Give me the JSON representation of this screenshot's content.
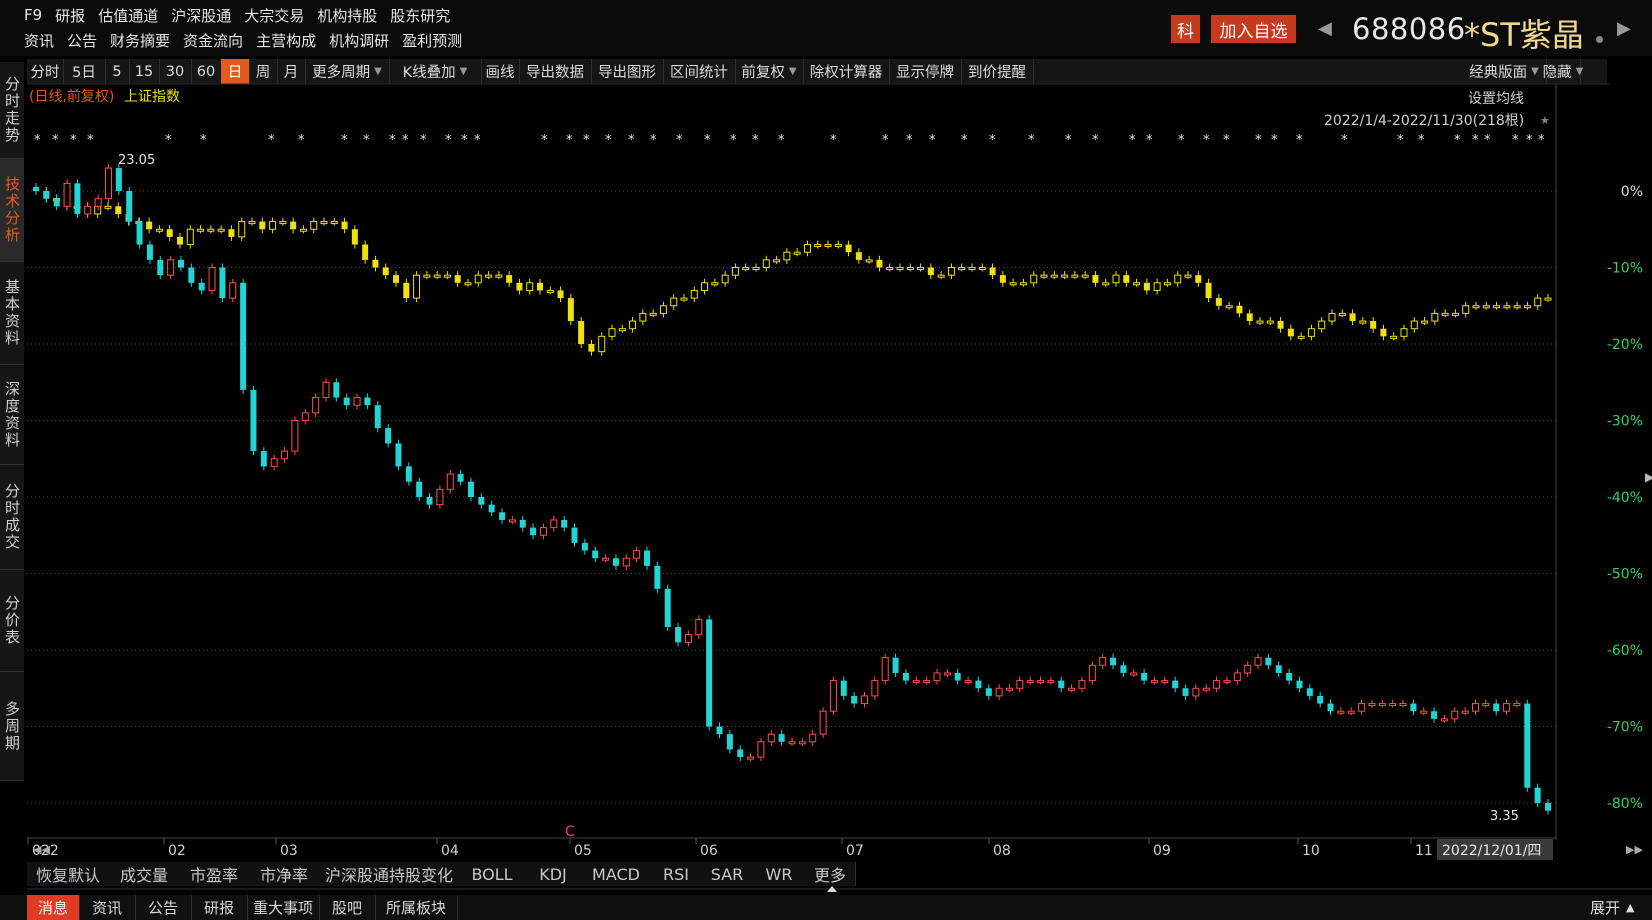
{
  "top_menu": {
    "row1": [
      "F9",
      "研报",
      "估值通道",
      "沪深股通",
      "大宗交易",
      "机构持股",
      "股东研究"
    ],
    "row2": [
      "资讯",
      "公告",
      "财务摘要",
      "资金流向",
      "主营构成",
      "机构调研",
      "盈利预测"
    ]
  },
  "header": {
    "market_badge": "科",
    "add_watchlist": "加入自选",
    "stock_code": "688086",
    "stock_name": "*ST紫晶"
  },
  "toolbar": {
    "items": [
      "分时",
      "5日",
      "5",
      "15",
      "30",
      "60",
      "日",
      "周",
      "月",
      "更多周期",
      "K线叠加",
      "画线",
      "导出数据",
      "导出图形",
      "区间统计",
      "前复权",
      "除权计算器",
      "显示停牌",
      "到价提醒"
    ],
    "active": "日",
    "right": [
      "经典版面",
      "隐藏"
    ]
  },
  "sidebar": {
    "items": [
      "分时走势",
      "技术分析",
      "基本资料",
      "深度资料",
      "分时成交",
      "分价表",
      "多周期"
    ],
    "active": "技术分析"
  },
  "chart_info": {
    "mode_label": "(日线,前复权)",
    "overlay_label": "上证指数",
    "ma_button": "设置均线",
    "range_label": "2022/1/4-2022/11/30(218根)",
    "high_marker": "23.05",
    "low_marker": "3.35",
    "cursor_date": "2022/12/01/四",
    "event_marker": "C"
  },
  "chart_data": {
    "type": "candlestick",
    "y_axis": {
      "labels": [
        "0%",
        "-10%",
        "-20%",
        "-30%",
        "-40%",
        "-50%",
        "-60%",
        "-70%",
        "-80%"
      ]
    },
    "x_axis": {
      "labels": [
        "022",
        "02",
        "03",
        "04",
        "05",
        "06",
        "07",
        "08",
        "09",
        "10",
        "11"
      ]
    },
    "series": [
      {
        "name": "*ST紫晶",
        "color_up": "#ff4d4d",
        "color_down": "#22d4d4",
        "close_pct": [
          0,
          -1,
          -2,
          1,
          -3,
          -2,
          -1,
          3,
          0,
          -4,
          -7,
          -9,
          -11,
          -9,
          -10,
          -12,
          -13,
          -10,
          -14,
          -12,
          -26,
          -34,
          -36,
          -35,
          -34,
          -30,
          -29,
          -27,
          -25,
          -27,
          -28,
          -27,
          -28,
          -31,
          -33,
          -36,
          -38,
          -40,
          -41,
          -39,
          -37,
          -38,
          -40,
          -41,
          -42,
          -43,
          -43,
          -44,
          -45,
          -44,
          -43,
          -44,
          -46,
          -47,
          -48,
          -48,
          -49,
          -48,
          -47,
          -49,
          -52,
          -57,
          -59,
          -58,
          -56,
          -70,
          -71,
          -73,
          -74,
          -74,
          -72,
          -71,
          -72,
          -72,
          -72,
          -71,
          -68,
          -64,
          -66,
          -67,
          -66,
          -64,
          -61,
          -63,
          -64,
          -64,
          -64,
          -63,
          -63,
          -64,
          -64,
          -65,
          -66,
          -65,
          -65,
          -64,
          -64,
          -64,
          -64,
          -65,
          -65,
          -64,
          -62,
          -61,
          -62,
          -63,
          -63,
          -64,
          -64,
          -64,
          -65,
          -66,
          -65,
          -65,
          -64,
          -64,
          -63,
          -62,
          -61,
          -62,
          -63,
          -64,
          -65,
          -66,
          -67,
          -68,
          -68,
          -68,
          -67,
          -67,
          -67,
          -67,
          -67,
          -68,
          -68,
          -69,
          -69,
          -68,
          -68,
          -67,
          -67,
          -68,
          -67,
          -67,
          -78,
          -80,
          -81
        ]
      },
      {
        "name": "上证指数",
        "color": "#f0e010",
        "close_pct": [
          0,
          -1,
          -1,
          -2,
          -2,
          -3,
          -2,
          -2,
          -3,
          -4,
          -4,
          -5,
          -5,
          -6,
          -7,
          -5,
          -5,
          -5,
          -5,
          -6,
          -4,
          -4,
          -5,
          -4,
          -4,
          -5,
          -5,
          -4,
          -4,
          -4,
          -5,
          -7,
          -9,
          -10,
          -11,
          -12,
          -14,
          -11,
          -11,
          -11,
          -11,
          -12,
          -12,
          -11,
          -11,
          -11,
          -12,
          -13,
          -12,
          -13,
          -13,
          -14,
          -17,
          -20,
          -21,
          -19,
          -18,
          -18,
          -17,
          -16,
          -16,
          -15,
          -14,
          -14,
          -13,
          -12,
          -12,
          -11,
          -10,
          -10,
          -10,
          -9,
          -9,
          -8,
          -8,
          -7,
          -7,
          -7,
          -7,
          -8,
          -9,
          -9,
          -10,
          -10,
          -10,
          -10,
          -10,
          -11,
          -11,
          -10,
          -10,
          -10,
          -10,
          -11,
          -12,
          -12,
          -12,
          -11,
          -11,
          -11,
          -11,
          -11,
          -11,
          -12,
          -12,
          -11,
          -12,
          -12,
          -13,
          -12,
          -12,
          -11,
          -11,
          -12,
          -14,
          -15,
          -15,
          -16,
          -17,
          -17,
          -17,
          -18,
          -19,
          -19,
          -18,
          -17,
          -16,
          -16,
          -17,
          -17,
          -18,
          -19,
          -19,
          -18,
          -17,
          -17,
          -16,
          -16,
          -16,
          -15,
          -15,
          -15,
          -15,
          -15,
          -15,
          -15,
          -14,
          -14
        ]
      }
    ]
  },
  "indicator_tabs": [
    "恢复默认",
    "成交量",
    "市盈率",
    "市净率",
    "沪深股通持股变化",
    "BOLL",
    "KDJ",
    "MACD",
    "RSI",
    "SAR",
    "WR",
    "更多"
  ],
  "news_tabs": [
    "消息",
    "资讯",
    "公告",
    "研报",
    "重大事项",
    "股吧",
    "所属板块"
  ],
  "news_active": "消息",
  "expand_label": "展开"
}
